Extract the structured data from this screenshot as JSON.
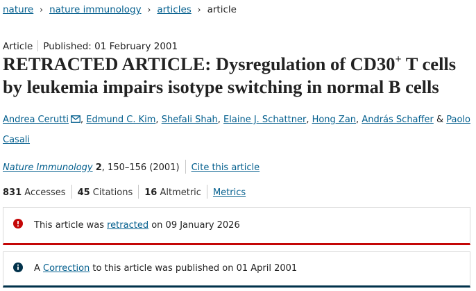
{
  "breadcrumb": {
    "items": [
      "nature",
      "nature immunology",
      "articles"
    ],
    "current": "article"
  },
  "meta": {
    "type": "Article",
    "published": "Published: 01 February 2001"
  },
  "title": {
    "prefix": "RETRACTED ARTICLE: Dysregulation of CD30",
    "superscript": "+",
    "suffix": " T cells by leukemia impairs isotype switching in normal B cells"
  },
  "authors": {
    "names": [
      "Andrea Cerutti",
      "Edmund C. Kim",
      "Shefali Shah",
      "Elaine J. Schattner",
      "Hong Zan",
      "András Schaffer",
      "Paolo Casali"
    ],
    "separator": ", ",
    "last_separator": " & "
  },
  "citation": {
    "journal": "Nature Immunology",
    "volume": "2",
    "pages_year": ", 150–156 (2001)",
    "cite_link": "Cite this article"
  },
  "metrics": {
    "accesses_value": "831",
    "accesses_label": "Accesses",
    "citations_value": "45",
    "citations_label": "Citations",
    "altmetric_value": "16",
    "altmetric_label": "Altmetric",
    "metrics_link": "Metrics"
  },
  "notices": {
    "retraction": {
      "text_before": "This article was ",
      "link": "retracted",
      "text_after": " on 09 January 2026",
      "icon": "exclamation-circle-icon",
      "color": "#c40606"
    },
    "correction": {
      "text_before": "A ",
      "link": "Correction",
      "text_after": " to this article was published on 01 April 2001",
      "icon": "info-circle-icon",
      "color": "#01324b"
    }
  },
  "colors": {
    "link": "#025e8d",
    "text": "#222222",
    "retraction_accent": "#c40606",
    "correction_accent": "#01324b"
  }
}
